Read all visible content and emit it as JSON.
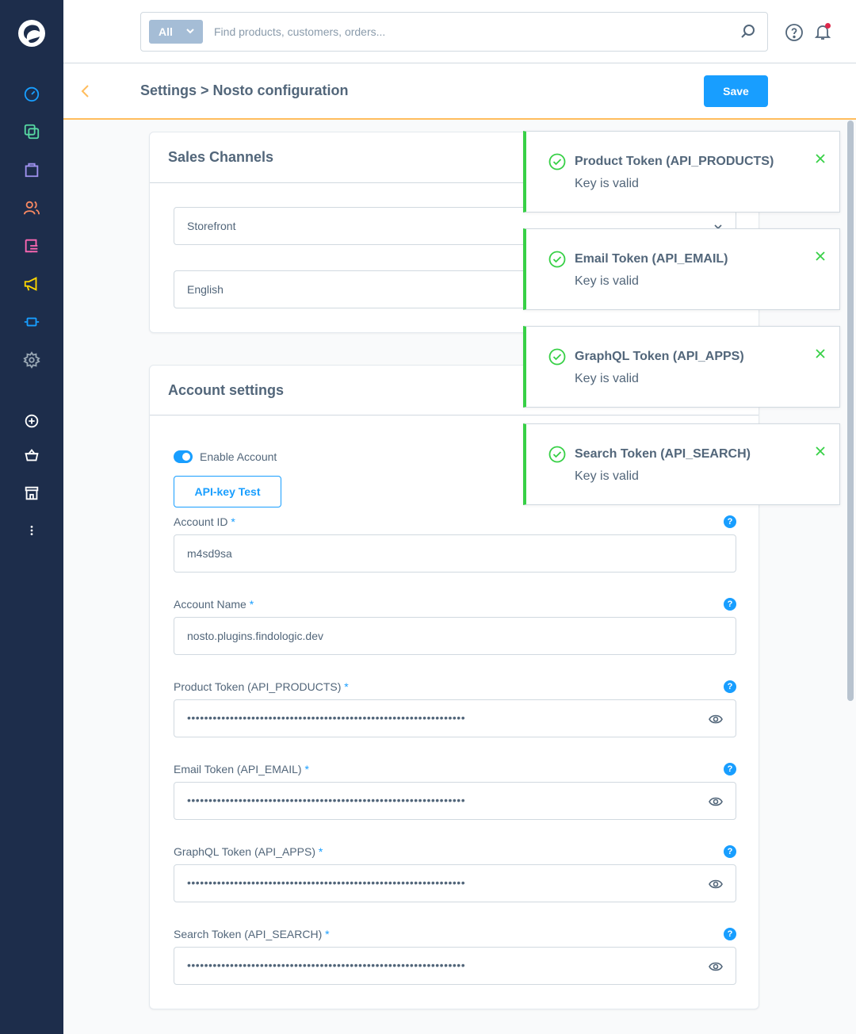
{
  "sidebar": {
    "logo": "shopware-logo",
    "items": [
      {
        "icon": "dashboard-icon",
        "color": "#57d9a3"
      },
      {
        "icon": "products-icon",
        "color": "#57d9a3"
      },
      {
        "icon": "orders-icon",
        "color": "#a092f0"
      },
      {
        "icon": "customers-icon",
        "color": "#f88962"
      },
      {
        "icon": "content-icon",
        "color": "#ff68b4"
      },
      {
        "icon": "marketing-icon",
        "color": "#ffd700"
      },
      {
        "icon": "extensions-icon",
        "color": "#189eff"
      },
      {
        "icon": "settings-icon",
        "color": "#9aa8b5"
      },
      {
        "icon": "add-sales-channel-icon",
        "color": "#ffffff"
      },
      {
        "icon": "basket-icon",
        "color": "#ffffff"
      },
      {
        "icon": "storefront-icon",
        "color": "#ffffff"
      },
      {
        "icon": "more-icon",
        "color": "#ffffff"
      }
    ]
  },
  "topbar": {
    "search_type": "All",
    "search_placeholder": "Find products, customers, orders..."
  },
  "header": {
    "title": "Settings > Nosto configuration",
    "save_label": "Save"
  },
  "sales_channels": {
    "title": "Sales Channels",
    "channel_value": "Storefront",
    "language_value": "English"
  },
  "account": {
    "title": "Account settings",
    "enable_label": "Enable Account",
    "apitest_label": "API-key Test",
    "required_mark": "*",
    "help_mark": "?",
    "fields": [
      {
        "label": "Account ID",
        "value": "m4sd9sa"
      },
      {
        "label": "Account Name",
        "value": "nosto.plugins.findologic.dev"
      },
      {
        "label": "Product Token (API_PRODUCTS)",
        "value": "•••••••••••••••••••••••••••••••••••••••••••••••••••••••••••••••••"
      },
      {
        "label": "Email Token (API_EMAIL)",
        "value": "•••••••••••••••••••••••••••••••••••••••••••••••••••••••••••••••••"
      },
      {
        "label": "GraphQL Token (API_APPS)",
        "value": "•••••••••••••••••••••••••••••••••••••••••••••••••••••••••••••••••"
      },
      {
        "label": "Search Token (API_SEARCH)",
        "value": "•••••••••••••••••••••••••••••••••••••••••••••••••••••••••••••••••"
      }
    ]
  },
  "toasts": [
    {
      "title": "Product Token (API_PRODUCTS)",
      "message": "Key is valid"
    },
    {
      "title": "Email Token (API_EMAIL)",
      "message": "Key is valid"
    },
    {
      "title": "GraphQL Token (API_APPS)",
      "message": "Key is valid"
    },
    {
      "title": "Search Token (API_SEARCH)",
      "message": "Key is valid"
    }
  ],
  "colors": {
    "accent": "#189eff",
    "success": "#37d046",
    "sidebar": "#1d2d4b"
  }
}
